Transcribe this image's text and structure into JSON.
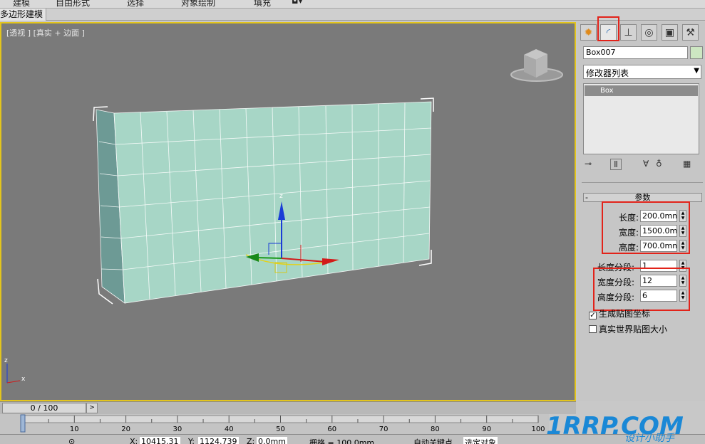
{
  "ribbon": {
    "tabs": [
      "建模",
      "自由形式",
      "选择",
      "对象绘制",
      "填充"
    ]
  },
  "subtab": {
    "label": "多边形建模"
  },
  "viewport": {
    "label": "[透视 ] [真实 + 边面 ]",
    "gizmo_axis": "z",
    "corner_axes": [
      "z",
      "x"
    ]
  },
  "panel": {
    "tabs": [
      {
        "name": "create-tab",
        "icon": "sun-icon"
      },
      {
        "name": "modify-tab",
        "icon": "modify-arc-icon"
      },
      {
        "name": "hierarchy-tab",
        "icon": "hierarchy-icon"
      },
      {
        "name": "motion-tab",
        "icon": "motion-icon"
      },
      {
        "name": "display-tab",
        "icon": "display-icon"
      },
      {
        "name": "utilities-tab",
        "icon": "hammer-icon"
      }
    ],
    "object_name": "Box007",
    "object_color": "#cde7c2",
    "modifier_list": "修改器列表",
    "stack_item": "Box",
    "rollout_title": "参数",
    "params": {
      "length_label": "长度:",
      "length_value": "200.0mm",
      "width_label": "宽度:",
      "width_value": "1500.0mm",
      "height_label": "高度:",
      "height_value": "700.0mm",
      "length_segs_label": "长度分段:",
      "length_segs_value": "1",
      "width_segs_label": "宽度分段:",
      "width_segs_value": "12",
      "height_segs_label": "高度分段:",
      "height_segs_value": "6"
    },
    "gen_mapping_label": "生成贴图坐标",
    "gen_mapping_checked": true,
    "real_world_label": "真实世界贴图大小",
    "real_world_checked": false
  },
  "timeline": {
    "frame": "0 / 100",
    "ticks": [
      "0",
      "10",
      "20",
      "30",
      "40",
      "50",
      "60",
      "70",
      "80",
      "90",
      "100"
    ]
  },
  "status": {
    "x_label": "X:",
    "x_value": "10415.31",
    "y_label": "Y:",
    "y_value": "1124.739",
    "z_label": "Z:",
    "z_value": "0.0mm",
    "grid": "栅格 = 100.0mm",
    "autokey": "自动关键点",
    "selected": "选定对象"
  },
  "watermark": {
    "logo": "1RRP.COM",
    "tagline": "设计小助手"
  },
  "colors": {
    "highlight": "#e2231a",
    "viewport_border": "#e3c51c",
    "box_face": "#a7d6c6",
    "box_side": "#6d9a95"
  }
}
